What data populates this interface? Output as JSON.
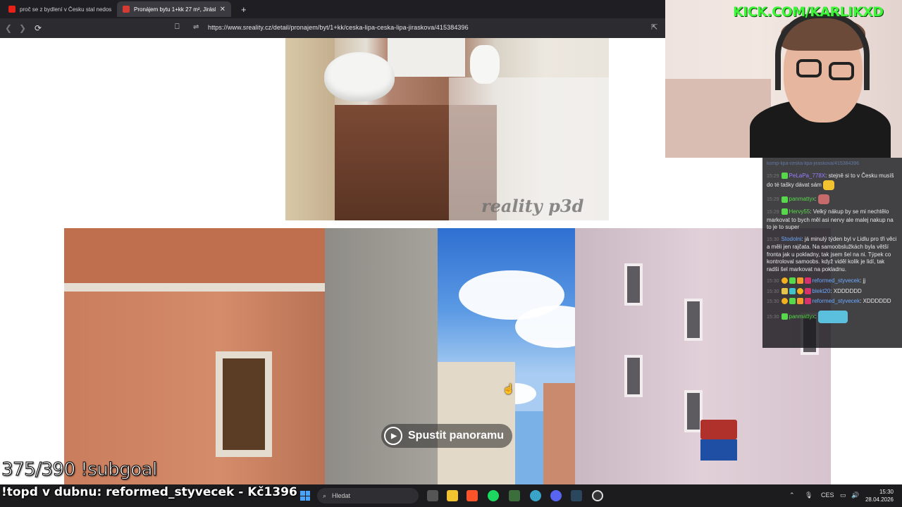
{
  "browser": {
    "tabs": [
      {
        "label": "proč se z bydlení v Česku stal nedostatek",
        "favicon_color": "#e62117"
      },
      {
        "label": "Pronájem bytu 1+kk 27 m², Jiráskova",
        "favicon_color": "#d33b33"
      }
    ],
    "url": "https://www.sreality.cz/detail/pronajem/byt/1+kk/ceska-lipa-ceska-lipa-jiraskova/415384396"
  },
  "page": {
    "watermark": "reality p3d",
    "panorama_button": "Spustit panoramu"
  },
  "webcam": {
    "channel_url": "KICK.COM/KARLIKXD"
  },
  "chat": {
    "top_line": "komp-lipa-ceska-lipa-jiraskova/415384396",
    "messages": [
      {
        "time": "15:29",
        "user": "PeLaPa_778X",
        "user_color": "#9a7dff",
        "text": "stejně si to v Česku musíš do té tašky dávat sám"
      },
      {
        "time": "15:29",
        "user": "panmattyx",
        "user_color": "#57d74a",
        "text": ""
      },
      {
        "time": "15:29",
        "user": "Hervy55",
        "user_color": "#57d74a",
        "text": "Velký nákup by se mi nechtělo markovat to bych měl asi nervy ale malej nakup na to je to super"
      },
      {
        "time": "15:30",
        "user": "Stodolni",
        "user_color": "#6ca9ff",
        "text": "já minulý týden byl v Lidlu pro tři věci a měli jen rajčata. Na samoobslužkách byla větší fronta jak u pokladny, tak jsem šel na ni. Týpek co kontroloval samoobs. když viděl kolik je lidí, tak radši šel markovat na pokladnu."
      },
      {
        "time": "15:30",
        "user": "reformed_styvecek",
        "user_color": "#6ca9ff",
        "text": "jj"
      },
      {
        "time": "15:30",
        "user": "blekt20",
        "user_color": "#6ca9ff",
        "text": "XDDDDDD"
      },
      {
        "time": "15:30",
        "user": "reformed_styvecek",
        "user_color": "#6ca9ff",
        "text": "XDDDDDD"
      },
      {
        "time": "15:30",
        "user": "panmattyx",
        "user_color": "#57d74a",
        "text": ""
      }
    ]
  },
  "overlay": {
    "subgoal": "375/390 !subgoal",
    "topd": "!topd v dubnu: reformed_styvecek - Kč1396"
  },
  "taskbar": {
    "search_placeholder": "Hledat",
    "lang": "CES",
    "time": "15:30",
    "date": "28.04.2026"
  }
}
